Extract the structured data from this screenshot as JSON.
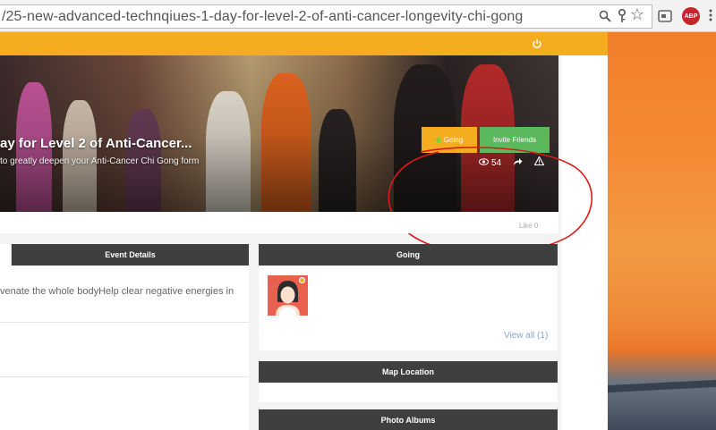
{
  "browser": {
    "url": "/25-new-advanced-technqiues-1-day-for-level-2-of-anti-cancer-longevity-chi-gong",
    "icons": [
      "zoom-icon",
      "key-icon",
      "star-icon",
      "cast-icon",
      "adblock-icon",
      "menu-icon"
    ],
    "abp_label": "ABP"
  },
  "hero": {
    "title": "ay for Level 2 of Anti-Cancer...",
    "subtitle": "to greatly deepen your Anti-Cancer Chi Gong form",
    "going_label": "Going",
    "invite_label": "Invite Friends",
    "views": "54"
  },
  "like_bar": {
    "label": "Like 0"
  },
  "tabs": {
    "details_label": "Event Details"
  },
  "details": {
    "text_line1": "venate the whole bodyHelp clear negative energies in"
  },
  "going_panel": {
    "title": "Going",
    "view_all": "View all (1)"
  },
  "map_panel": {
    "title": "Map Location"
  },
  "photos_panel": {
    "title": "Photo Albums"
  },
  "colors": {
    "accent": "#f5ad20",
    "invite": "#5cb85c",
    "panel_header": "#3f3f3f",
    "annotation": "#d91a1a"
  }
}
